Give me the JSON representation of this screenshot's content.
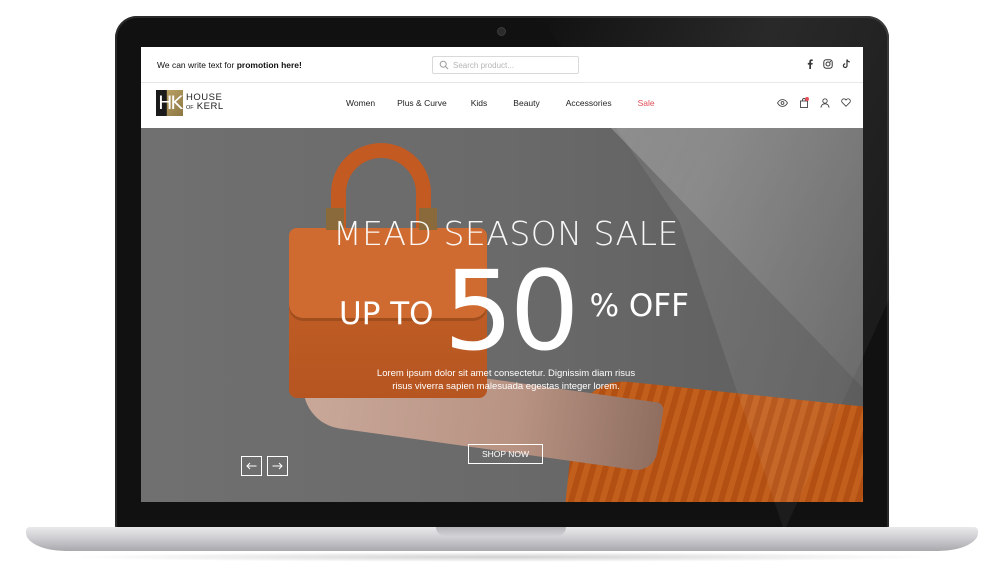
{
  "promo": {
    "text_prefix": "We can write text for ",
    "text_bold": "promotion here!"
  },
  "search": {
    "placeholder": "Search product...",
    "value": ""
  },
  "socials": [
    "facebook-icon",
    "instagram-icon",
    "tiktok-icon"
  ],
  "logo": {
    "mark": "HK",
    "line1": "HOUSE",
    "line2_small": "OF",
    "line2": "KERL"
  },
  "nav": {
    "items": [
      {
        "label": "Women"
      },
      {
        "label": "Plus & Curve"
      },
      {
        "label": "Kids"
      },
      {
        "label": "Beauty"
      },
      {
        "label": "Accessories"
      },
      {
        "label": "Sale"
      }
    ]
  },
  "header_icons": [
    "eye-icon",
    "cart-icon",
    "user-icon",
    "heart-icon"
  ],
  "hero": {
    "title": "MEAD SEASON SALE",
    "offer_prefix": "UP TO",
    "offer_number": "50",
    "offer_suffix": "% OFF",
    "body": "Lorem ipsum dolor sit amet consectetur. Dignissim diam risus risus viverra sapien malesuada egestas integer lorem.",
    "cta": "SHOP NOW",
    "prev_icon": "arrow-left-icon",
    "next_icon": "arrow-right-icon"
  },
  "colors": {
    "sale_accent": "#e0414c",
    "hero_bg": "#6a6a6a",
    "bag_orange": "#c25a22",
    "logo_gold": "#c4aa6a"
  }
}
